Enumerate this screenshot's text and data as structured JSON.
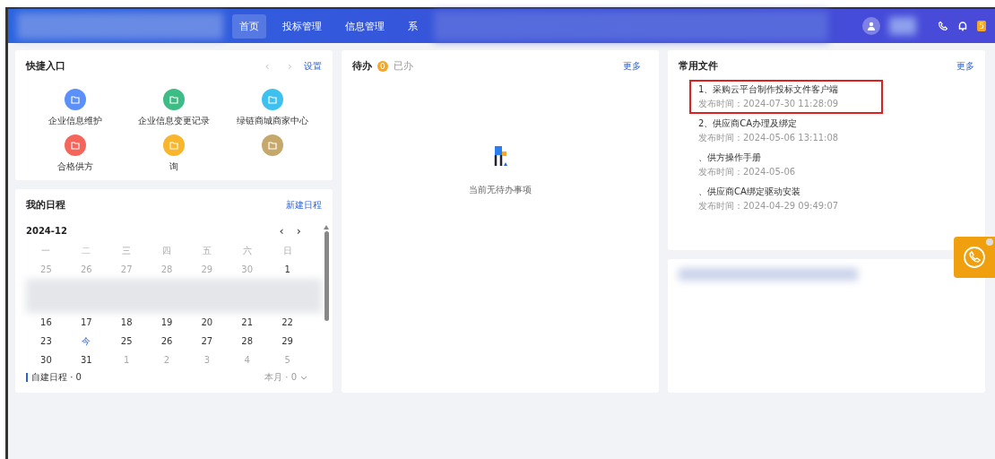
{
  "nav": {
    "tabs": [
      {
        "label": "首页",
        "selected": true
      },
      {
        "label": "投标管理",
        "selected": false
      },
      {
        "label": "信息管理",
        "selected": false
      },
      {
        "label": "系",
        "selected": false
      }
    ],
    "notification_count": "5"
  },
  "quick_entry": {
    "title": "快捷入口",
    "settings": "设置",
    "items": [
      {
        "label": "企业信息维护",
        "color": "#5b8ff9"
      },
      {
        "label": "企业信息变更记录",
        "color": "#3dbd85"
      },
      {
        "label": "绿链商城商家中心",
        "color": "#3fc1f0"
      },
      {
        "label": "合格供方",
        "color": "#f5655b"
      },
      {
        "label": "询",
        "color": "#f9b52c"
      },
      {
        "color": "#c6a86c"
      }
    ],
    "prev": "‹",
    "next": "›"
  },
  "schedule": {
    "title": "我的日程",
    "new": "新建日程",
    "month": "2024-12",
    "prev": "‹",
    "next": "›",
    "weekdays": [
      "一",
      "二",
      "三",
      "四",
      "五",
      "六",
      "日"
    ],
    "weeks": [
      [
        {
          "d": "25",
          "kind": "other"
        },
        {
          "d": "26",
          "kind": "other"
        },
        {
          "d": "27",
          "kind": "other"
        },
        {
          "d": "28",
          "kind": "other"
        },
        {
          "d": "29",
          "kind": "other"
        },
        {
          "d": "30",
          "kind": "other"
        },
        {
          "d": "1",
          "kind": "current"
        }
      ],
      [
        {
          "d": "16",
          "kind": "current"
        },
        {
          "d": "17",
          "kind": "current"
        },
        {
          "d": "18",
          "kind": "current"
        },
        {
          "d": "19",
          "kind": "current"
        },
        {
          "d": "20",
          "kind": "current"
        },
        {
          "d": "21",
          "kind": "current"
        },
        {
          "d": "22",
          "kind": "current"
        }
      ],
      [
        {
          "d": "23",
          "kind": "current"
        },
        {
          "d": "今",
          "kind": "today"
        },
        {
          "d": "25",
          "kind": "current"
        },
        {
          "d": "26",
          "kind": "current"
        },
        {
          "d": "27",
          "kind": "current"
        },
        {
          "d": "28",
          "kind": "current"
        },
        {
          "d": "29",
          "kind": "current"
        }
      ],
      [
        {
          "d": "30",
          "kind": "current"
        },
        {
          "d": "31",
          "kind": "current"
        },
        {
          "d": "1",
          "kind": "other"
        },
        {
          "d": "2",
          "kind": "other"
        },
        {
          "d": "3",
          "kind": "other"
        },
        {
          "d": "4",
          "kind": "other"
        },
        {
          "d": "5",
          "kind": "other"
        }
      ]
    ],
    "own": "自建日程 · 0",
    "range": "本月 · 0"
  },
  "todo": {
    "tabs": [
      {
        "label": "待办",
        "selected": true,
        "count": "0"
      },
      {
        "label": "已办",
        "selected": false
      }
    ],
    "more": "更多",
    "empty": "当前无待办事项"
  },
  "files": {
    "title": "常用文件",
    "more": "更多",
    "items": [
      {
        "name": "1、采购云平台制作投标文件客户端",
        "time": "发布时间：2024-07-30 11:28:09",
        "highlighted": true
      },
      {
        "name": "2、供应商CA办理及绑定",
        "time": "发布时间：2024-05-06 13:11:08",
        "highlighted": false
      },
      {
        "name": "、供方操作手册",
        "time": "发布时间：2024-05-06",
        "highlighted": false
      },
      {
        "name": "、供应商CA绑定驱动安装",
        "time": "发布时间：2024-04-29 09:49:07",
        "highlighted": false
      }
    ]
  }
}
